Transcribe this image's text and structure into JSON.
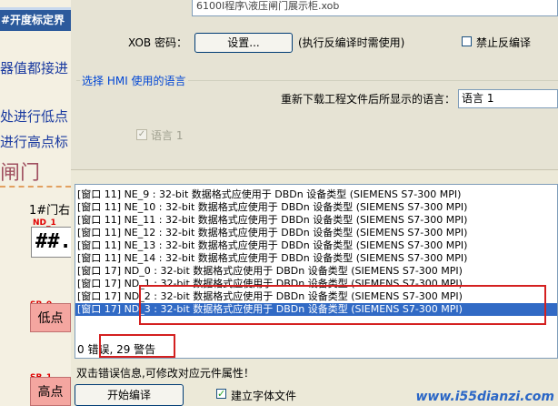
{
  "background": {
    "title": "#开度标定界",
    "lines": [
      "器值都接进",
      "处进行低点",
      "进行高点标"
    ],
    "door_text": "闸门",
    "gate_label": "1#门右",
    "nd_tag": "ND_1",
    "value_display": "##.",
    "sb0_tag": "SB_0",
    "low_button": "低点",
    "sb1_tag": "SB_1",
    "high_button": "高点"
  },
  "dialog": {
    "path": "6100I程序\\液压闸门展示柜.xob",
    "xob_password_label": "XOB 密码：",
    "set_button": "设置...",
    "xob_note": "(执行反编译时需使用)",
    "no_decompile_label": "禁止反编译",
    "no_decompile_checked": false,
    "group_title": "选择 HMI 使用的语言",
    "reload_lang_label": "重新下载工程文件后所显示的语言：",
    "lang_selected": "语言 1",
    "lang1_label": "语言 1",
    "lang1_checked": true,
    "messages": [
      "[窗口 11] NE_9 : 32-bit 数据格式应使用于 DBDn 设备类型 (SIEMENS S7-300 MPI)",
      "[窗口 11] NE_10 : 32-bit 数据格式应使用于 DBDn 设备类型 (SIEMENS S7-300 MPI)",
      "[窗口 11] NE_11 : 32-bit 数据格式应使用于 DBDn 设备类型 (SIEMENS S7-300 MPI)",
      "[窗口 11] NE_12 : 32-bit 数据格式应使用于 DBDn 设备类型 (SIEMENS S7-300 MPI)",
      "[窗口 11] NE_13 : 32-bit 数据格式应使用于 DBDn 设备类型 (SIEMENS S7-300 MPI)",
      "[窗口 11] NE_14 : 32-bit 数据格式应使用于 DBDn 设备类型 (SIEMENS S7-300 MPI)",
      "[窗口 17] ND_0 : 32-bit 数据格式应使用于 DBDn 设备类型 (SIEMENS S7-300 MPI)",
      "[窗口 17] ND_1 : 32-bit 数据格式应使用于 DBDn 设备类型 (SIEMENS S7-300 MPI)",
      "[窗口 17] ND_2 : 32-bit 数据格式应使用于 DBDn 设备类型 (SIEMENS S7-300 MPI)",
      "[窗口 17] ND_3 : 32-bit 数据格式应使用于 DBDn 设备类型 (SIEMENS S7-300 MPI)"
    ],
    "selected_message_index": 9,
    "summary": "0 错误, 29 警告",
    "hint": "双击错误信息,可修改对应元件属性！",
    "compile_button": "开始编译",
    "build_font_label": "建立字体文件",
    "build_font_checked": true,
    "watermark": "www.i55dianzi.com"
  },
  "colors": {
    "selection": "#316ac5",
    "highlight_box": "#d42020",
    "group_title": "#0046d5"
  }
}
